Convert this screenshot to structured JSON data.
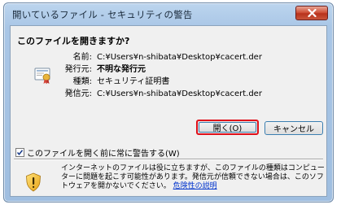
{
  "window": {
    "title": "開いているファイル - セキュリティの警告"
  },
  "dialog": {
    "heading": "このファイルを開きますか?",
    "fields": [
      {
        "label": "名前:",
        "value": "C:¥Users¥n-shibata¥Desktop¥cacert.der",
        "bold": false
      },
      {
        "label": "発行元:",
        "value": "不明な発行元",
        "bold": true
      },
      {
        "label": "種類:",
        "value": "セキュリティ証明書",
        "bold": false
      },
      {
        "label": "発信元:",
        "value": "C:¥Users¥n-shibata¥Desktop¥cacert.der",
        "bold": false
      }
    ],
    "open_button": "開く(O)",
    "cancel_button": "キャンセル",
    "checkbox_label": "このファイルを開く前に常に警告する(W)",
    "checkbox_checked": true,
    "warning": {
      "text": "インターネットのファイルは役に立ちますが、このファイルの種類はコンピューターに問題を起こす可能性があります。発信元が信頼できない場合は、このソフトウェアを開かないでください。",
      "link": "危険性の説明"
    }
  },
  "colors": {
    "highlight_border": "#e0101a",
    "link": "#0033cc",
    "close_button": "#c9553a"
  }
}
